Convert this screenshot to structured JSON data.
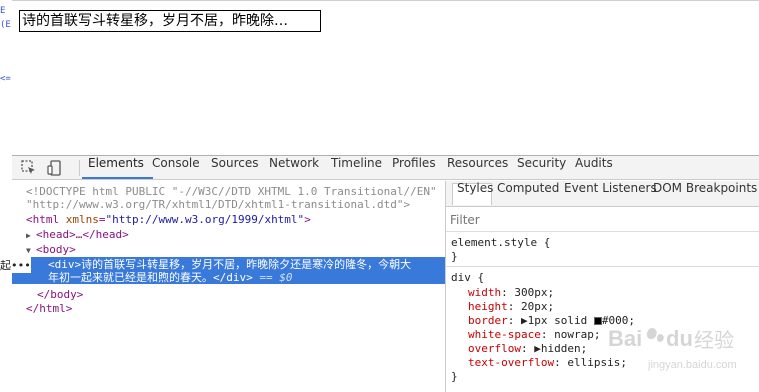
{
  "page": {
    "demo_text": "诗的首联写斗转星移，岁月不居，昨晚除…"
  },
  "left_strip": {
    "glyphs": [
      "E",
      "(E",
      "<="
    ]
  },
  "toolbar": {
    "tabs": [
      "Elements",
      "Console",
      "Sources",
      "Network",
      "Timeline",
      "Profiles",
      "Resources",
      "Security",
      "Audits"
    ],
    "active_tab": "Elements"
  },
  "elements_panel": {
    "doctype_1": "<!DOCTYPE html PUBLIC \"-//W3C//DTD XHTML 1.0 Transitional//EN\"",
    "doctype_2": "\"http://www.w3.org/TR/xhtml1/DTD/xhtml1-transitional.dtd\">",
    "html_open_tag": "<html",
    "html_attr": "xmlns",
    "html_attr_eq": "=",
    "html_attr_value": "\"http://www.w3.org/1999/xhtml\"",
    "html_open_close": ">",
    "head": "<head>…</head>",
    "body_open": "<body>",
    "div_open": "<div>",
    "div_text_line1": "诗的首联写斗转星移，岁月不居，昨晚除夕还是寒冷的隆冬，今朝大",
    "div_text_line2": "年初一起来就已经是和煦的春天。",
    "div_close": "</div>",
    "eq_ref": "== $0",
    "body_close": "</body>",
    "html_close": "</html>",
    "gutter_dots": "起•••"
  },
  "styles_panel": {
    "subtabs": [
      "Styles",
      "Computed",
      "Event Listeners",
      "DOM Breakpoints"
    ],
    "filter_placeholder": "Filter",
    "element_style_selector": "element.style {",
    "close_brace": "}",
    "div_selector": "div {",
    "declarations": [
      {
        "prop": "width",
        "value": "300px;"
      },
      {
        "prop": "height",
        "value": "20px;"
      },
      {
        "prop": "border",
        "value": "▶1px solid ",
        "extra": "#000;"
      },
      {
        "prop": "white-space",
        "value": "nowrap;"
      },
      {
        "prop": "overflow",
        "value": "▶hidden;"
      },
      {
        "prop": "text-overflow",
        "value": "ellipsis;"
      }
    ]
  },
  "colors": {
    "selection": "#3879d9",
    "tag": "#881280",
    "attr": "#994500",
    "attr_value": "#1a1aa6",
    "css_prop": "#c80000"
  },
  "watermark": {
    "brand": "Baidu",
    "subtitle": "经验",
    "url": "jingyan.baidu.com"
  }
}
